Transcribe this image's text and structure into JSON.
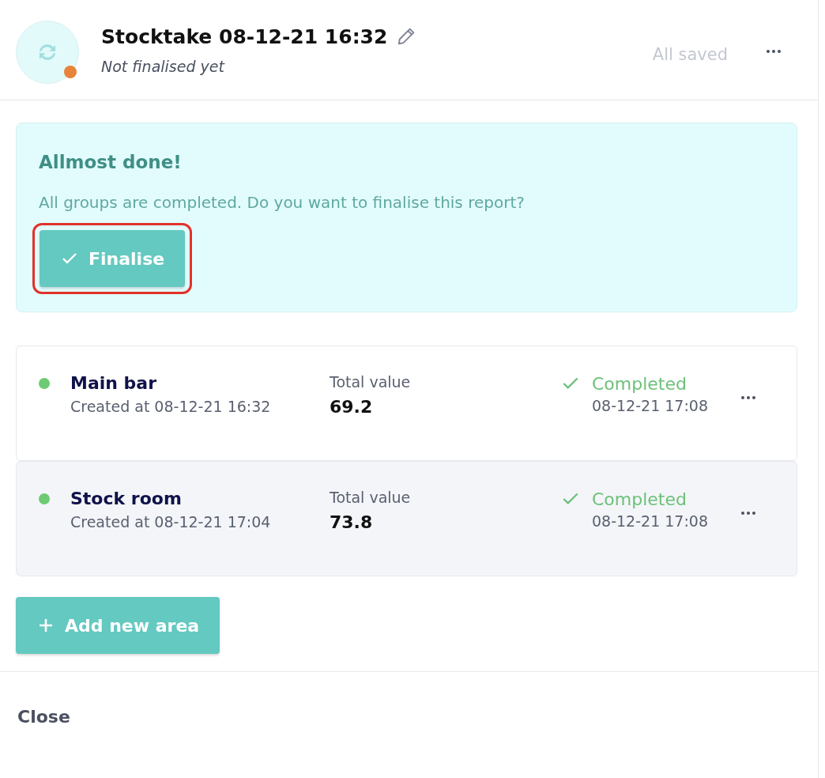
{
  "header": {
    "title": "Stocktake 08-12-21 16:32",
    "subtitle": "Not finalised yet",
    "save_status": "All saved"
  },
  "banner": {
    "heading": "Allmost done!",
    "message": "All groups are completed. Do you want to finalise this report?",
    "button": {
      "label": "Finalise",
      "highlighted": true
    }
  },
  "areas": [
    {
      "name": "Main bar",
      "created": "Created at 08-12-21 16:32",
      "value_label": "Total value",
      "value": "69.2",
      "status": "Completed",
      "completed": true,
      "status_time": "08-12-21 17:08",
      "selected": false
    },
    {
      "name": "Stock room",
      "created": "Created at 08-12-21 17:04",
      "value_label": "Total value",
      "value": "73.8",
      "status": "Completed",
      "completed": true,
      "status_time": "08-12-21 17:08",
      "selected": true
    }
  ],
  "add_button": "Add new area",
  "close_button": "Close"
}
